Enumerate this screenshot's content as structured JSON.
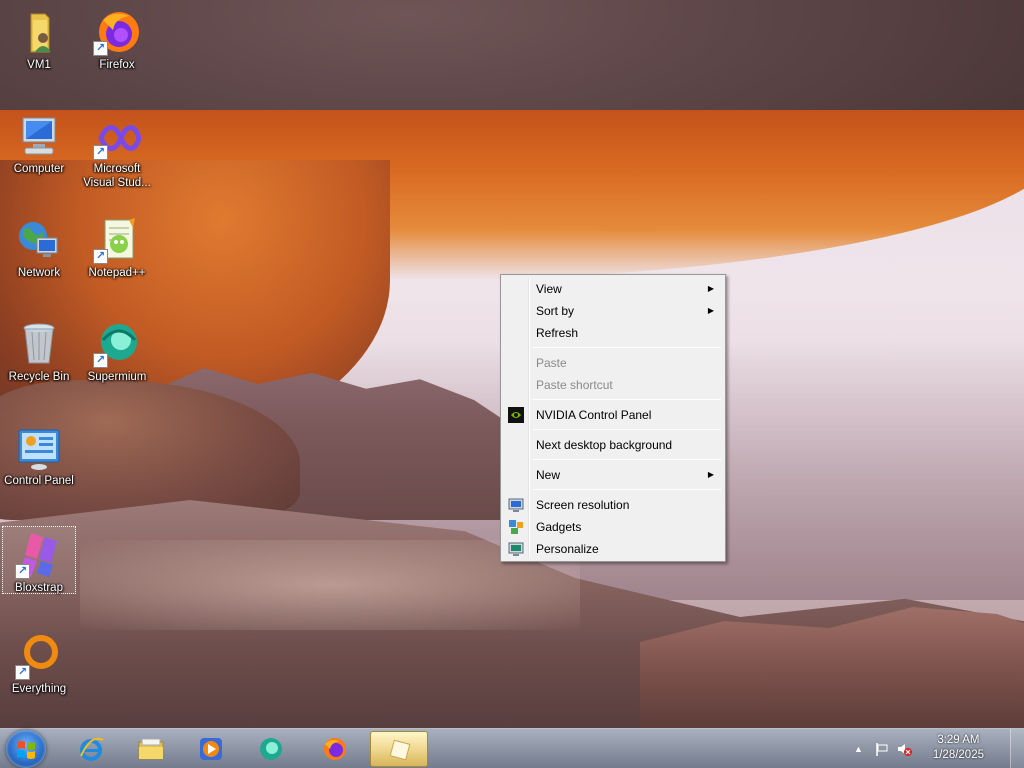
{
  "desktop_icons": [
    {
      "label": "VM1",
      "icon": "folder-user-icon"
    },
    {
      "label": "Firefox",
      "icon": "firefox-icon"
    },
    {
      "label": "Computer",
      "icon": "computer-icon"
    },
    {
      "label": "Microsoft\nVisual Stud...",
      "icon": "visual-studio-icon"
    },
    {
      "label": "Network",
      "icon": "network-icon"
    },
    {
      "label": "Notepad++",
      "icon": "notepad-plus-plus-icon"
    },
    {
      "label": "Recycle Bin",
      "icon": "recycle-bin-icon"
    },
    {
      "label": "Supermium",
      "icon": "supermium-icon"
    },
    {
      "label": "Control Panel",
      "icon": "control-panel-icon"
    },
    {
      "label": "Bloxstrap",
      "icon": "bloxstrap-icon"
    },
    {
      "label": "Everything",
      "icon": "everything-search-icon"
    }
  ],
  "context_menu": {
    "view": "View",
    "sort_by": "Sort by",
    "refresh": "Refresh",
    "paste": "Paste",
    "paste_shortcut": "Paste shortcut",
    "nvidia": "NVIDIA Control Panel",
    "next_background": "Next desktop background",
    "new": "New",
    "screen_resolution": "Screen resolution",
    "gadgets": "Gadgets",
    "personalize": "Personalize"
  },
  "taskbar": {
    "pinned": [
      "internet-explorer-icon",
      "file-explorer-icon",
      "media-player-icon",
      "supermium-icon",
      "firefox-icon",
      "active-app-icon"
    ],
    "clock_time": "3:29 AM",
    "clock_date": "1/28/2025"
  },
  "colors": {
    "menu_bg": "#f0f0f0",
    "disabled_text": "#8a8a8a",
    "taskbar_active": "#f0d890"
  }
}
